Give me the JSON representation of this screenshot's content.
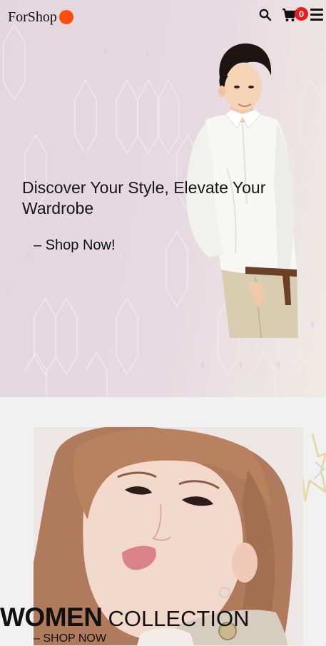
{
  "header": {
    "logo_text": "ForShop",
    "cart_count": "0",
    "icons": [
      "search-icon",
      "cart-icon",
      "hamburger-menu-icon"
    ]
  },
  "hero": {
    "headline": "Discover Your Style, Elevate Your Wardrobe",
    "cta": "– Shop Now!"
  },
  "collection": {
    "title_strong": "WOMEN",
    "title_light": "COLLECTION",
    "link": "– SHOP NOW"
  },
  "colors": {
    "brand_dot": "#ff4d10",
    "cart_badge": "#f01919",
    "hero_bg": "#e5d8df",
    "page_bg": "#f1f1f1",
    "text": "#111111"
  }
}
